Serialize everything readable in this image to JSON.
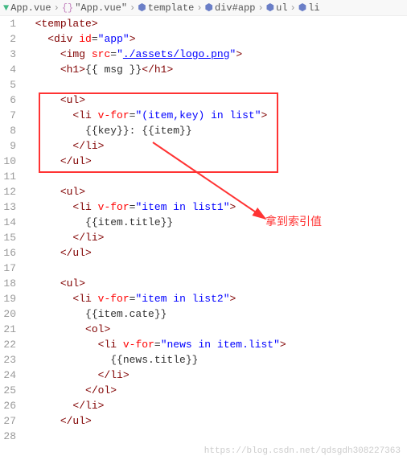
{
  "breadcrumb": {
    "file": "App.vue",
    "scope": "\"App.vue\"",
    "items": [
      "template",
      "div#app",
      "ul",
      "li"
    ]
  },
  "gutter": [
    "1",
    "2",
    "3",
    "4",
    "5",
    "6",
    "7",
    "8",
    "9",
    "10",
    "11",
    "12",
    "13",
    "14",
    "15",
    "16",
    "17",
    "18",
    "19",
    "20",
    "21",
    "22",
    "23",
    "24",
    "25",
    "26",
    "27",
    "28"
  ],
  "code": {
    "l1": {
      "t1": "<",
      "t2": "template",
      "t3": ">"
    },
    "l2": {
      "t1": "<",
      "t2": "div",
      "a1": "id",
      "eq": "=",
      "v1": "\"app\"",
      "t3": ">"
    },
    "l3": {
      "t1": "<",
      "t2": "img",
      "a1": "src",
      "eq": "=",
      "v1": "\"",
      "v2": "./assets/logo.png",
      "v3": "\"",
      "t3": ">"
    },
    "l4": {
      "t1": "<",
      "t2": "h1",
      "t3": ">",
      "c": "{{ msg }}",
      "t4": "</",
      "t5": "h1",
      "t6": ">"
    },
    "l6": {
      "t1": "<",
      "t2": "ul",
      "t3": ">"
    },
    "l7": {
      "t1": "<",
      "t2": "li",
      "a1": "v-for",
      "eq": "=",
      "v1": "\"(item,key) in list\"",
      "t3": ">"
    },
    "l8": {
      "c": "{{key}}: {{item}}"
    },
    "l9": {
      "t1": "</",
      "t2": "li",
      "t3": ">"
    },
    "l10": {
      "t1": "</",
      "t2": "ul",
      "t3": ">"
    },
    "l12": {
      "t1": "<",
      "t2": "ul",
      "t3": ">"
    },
    "l13": {
      "t1": "<",
      "t2": "li",
      "a1": "v-for",
      "eq": "=",
      "v1": "\"item in list1\"",
      "t3": ">"
    },
    "l14": {
      "c": "{{item.title}}"
    },
    "l15": {
      "t1": "</",
      "t2": "li",
      "t3": ">"
    },
    "l16": {
      "t1": "</",
      "t2": "ul",
      "t3": ">"
    },
    "l18": {
      "t1": "<",
      "t2": "ul",
      "t3": ">"
    },
    "l19": {
      "t1": "<",
      "t2": "li",
      "a1": "v-for",
      "eq": "=",
      "v1": "\"item in list2\"",
      "t3": ">"
    },
    "l20": {
      "c": "{{item.cate}}"
    },
    "l21": {
      "t1": "<",
      "t2": "ol",
      "t3": ">"
    },
    "l22": {
      "t1": "<",
      "t2": "li",
      "a1": "v-for",
      "eq": "=",
      "v1": "\"news in item.list\"",
      "t3": ">"
    },
    "l23": {
      "c": "{{news.title}}"
    },
    "l24": {
      "t1": "</",
      "t2": "li",
      "t3": ">"
    },
    "l25": {
      "t1": "</",
      "t2": "ol",
      "t3": ">"
    },
    "l26": {
      "t1": "</",
      "t2": "li",
      "t3": ">"
    },
    "l27": {
      "t1": "</",
      "t2": "ul",
      "t3": ">"
    }
  },
  "annotation": "拿到索引值",
  "watermark": "https://blog.csdn.net/qdsgdh308227363"
}
